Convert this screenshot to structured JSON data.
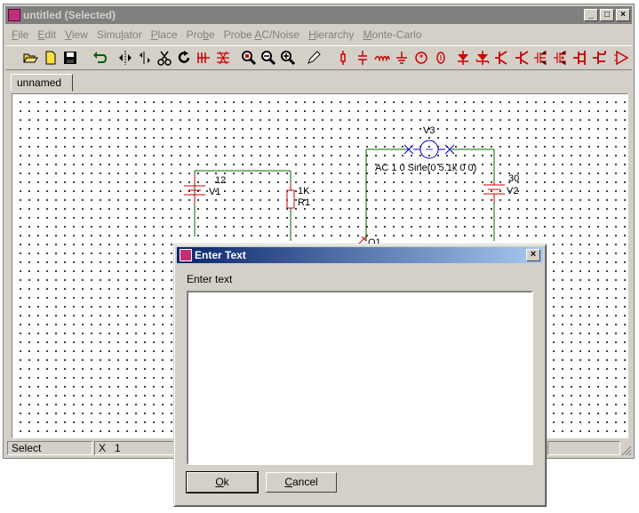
{
  "window": {
    "title": "untitled (Selected)",
    "controls": {
      "minimize": "_",
      "maximize": "□",
      "close": "×"
    }
  },
  "menu": [
    {
      "key": "F",
      "rest": "ile"
    },
    {
      "key": "E",
      "rest": "dit"
    },
    {
      "key": "V",
      "rest": "iew"
    },
    {
      "pre": "Simu",
      "key": "l",
      "rest": "ator"
    },
    {
      "key": "P",
      "rest": "lace"
    },
    {
      "pre": "Pro",
      "key": "b",
      "rest": "e"
    },
    {
      "pre": "Probe ",
      "key": "A",
      "rest": "C/Noise"
    },
    {
      "key": "H",
      "rest": "ierarchy"
    },
    {
      "key": "M",
      "rest": "onte-Carlo"
    }
  ],
  "tabs": [
    {
      "label": "unnamed"
    }
  ],
  "schematic": {
    "v1": {
      "name": "V1",
      "value": "12"
    },
    "r1": {
      "name": "R1",
      "value": "1K"
    },
    "v2": {
      "name": "V2",
      "value": "30"
    },
    "v3": {
      "name": "V3",
      "value": "AC 1 0 Sine(0 5.1k 0 0)"
    },
    "q1": {
      "name": "Q1"
    }
  },
  "status": {
    "mode": "Select",
    "x_label": "X",
    "x_value": "1"
  },
  "dialog": {
    "title": "Enter Text",
    "label": "Enter text",
    "text_value": "",
    "ok_key": "O",
    "ok_rest": "k",
    "cancel_key": "C",
    "cancel_rest": "ancel",
    "close": "×"
  },
  "colors": {
    "wire": "#006400",
    "component": "#cc0000",
    "source_ac": "#0000cc",
    "dialog_title_start": "#0a246a",
    "dialog_title_end": "#a6caf0"
  }
}
